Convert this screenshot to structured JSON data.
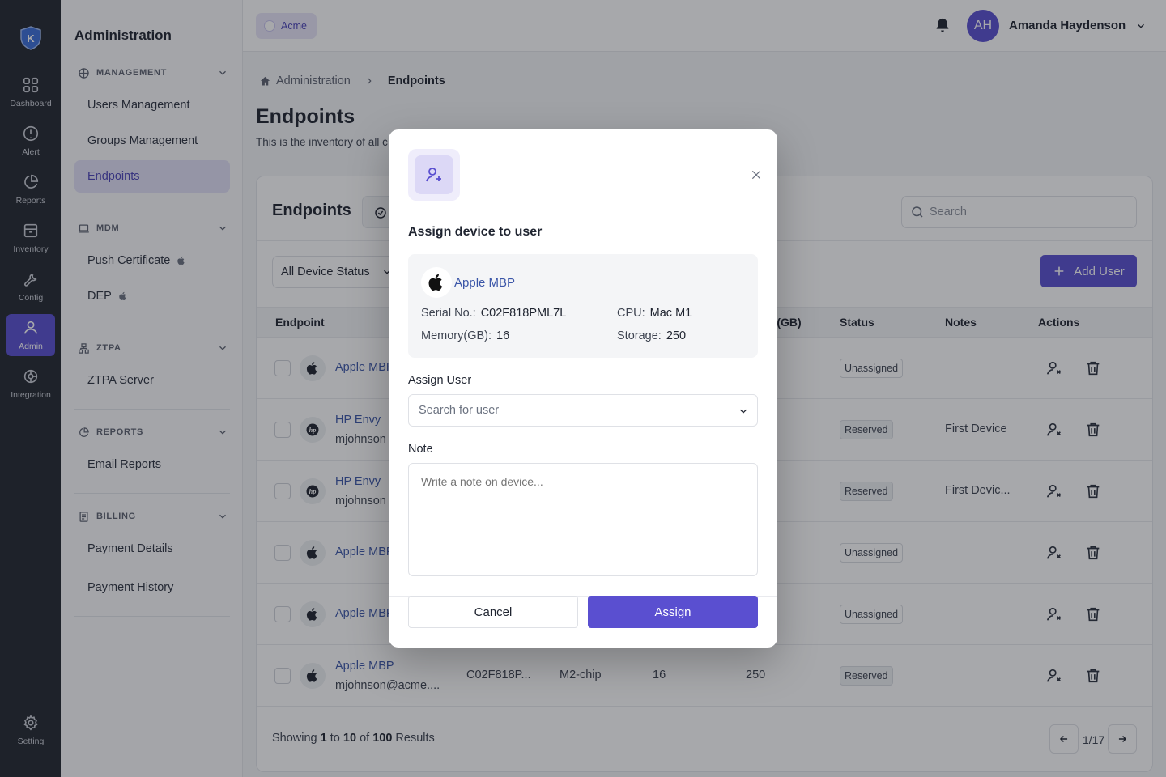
{
  "rail": {
    "items": [
      {
        "label": "Dashboard",
        "icon": "grid-icon"
      },
      {
        "label": "Alert",
        "icon": "alert-icon"
      },
      {
        "label": "Reports",
        "icon": "pie-chart-icon"
      },
      {
        "label": "Inventory",
        "icon": "archive-icon"
      },
      {
        "label": "Config",
        "icon": "wrench-icon"
      },
      {
        "label": "Admin",
        "icon": "users-icon"
      },
      {
        "label": "Integration",
        "icon": "integration-icon"
      }
    ],
    "setting_label": "Setting",
    "accent": "#5a4fd0"
  },
  "subnav": {
    "title": "Administration",
    "management": {
      "header": "MANAGEMENT",
      "items": [
        "Users Management",
        "Groups Management",
        "Endpoints"
      ]
    },
    "mdm": {
      "header": "MDM",
      "items": [
        "Push Certificate",
        "DEP"
      ]
    },
    "ztpa": {
      "header": "ZTPA",
      "items": [
        "ZTPA Server"
      ]
    },
    "reports": {
      "header": "REPORTS",
      "items": [
        "Email Reports"
      ]
    },
    "billing": {
      "header": "BILLING",
      "items": [
        "Payment Details",
        "Payment History"
      ]
    }
  },
  "topbar": {
    "org": "Acme",
    "avatar_initials": "AH",
    "user_name": "Amanda Haydenson"
  },
  "breadcrumb": {
    "root": "Administration",
    "current": "Endpoints"
  },
  "page": {
    "title": "Endpoints",
    "subtitle": "This is the inventory of all c"
  },
  "card": {
    "title": "Endpoints",
    "search_placeholder": "Search",
    "status_filter": "All Device Status",
    "add_button": "Add User",
    "columns": [
      "Endpoint",
      "ge(GB)",
      "Status",
      "Notes",
      "Actions"
    ],
    "rows": [
      {
        "name": "Apple MBP",
        "email": "",
        "os": "apple",
        "status": "Unassigned",
        "notes": ""
      },
      {
        "name": "HP Envy",
        "email": "mjohnson",
        "os": "hp",
        "status": "Reserved",
        "notes": "First Device"
      },
      {
        "name": "HP Envy",
        "email": "mjohnson",
        "os": "hp",
        "status": "Reserved",
        "notes": "First Devic..."
      },
      {
        "name": "Apple MBP",
        "email": "",
        "os": "apple",
        "status": "Unassigned",
        "notes": ""
      },
      {
        "name": "Apple MBP",
        "email": "",
        "os": "apple",
        "status": "Unassigned",
        "notes": ""
      },
      {
        "name": "Apple MBP",
        "email": "mjohnson@acme....",
        "os": "apple",
        "serial": "C02F818P...",
        "cpu": "M2-chip",
        "memory": "16",
        "storage": "250",
        "status": "Reserved",
        "notes": ""
      }
    ],
    "footer": {
      "prefix": "Showing",
      "from": "1",
      "to_word": "to",
      "to": "10",
      "of_word": "of",
      "total": "100",
      "suffix": "Results",
      "page": "1/17"
    }
  },
  "modal": {
    "title": "Assign device to user",
    "device": {
      "name": "Apple MBP",
      "serial_label": "Serial No.:",
      "serial": "C02F818PML7L",
      "cpu_label": "CPU:",
      "cpu": "Mac M1",
      "memory_label": "Memory(GB):",
      "memory": "16",
      "storage_label": "Storage:",
      "storage": "250"
    },
    "assign_label": "Assign User",
    "assign_placeholder": "Search for user",
    "note_label": "Note",
    "note_placeholder": "Write a note on device...",
    "cancel": "Cancel",
    "assign": "Assign"
  }
}
